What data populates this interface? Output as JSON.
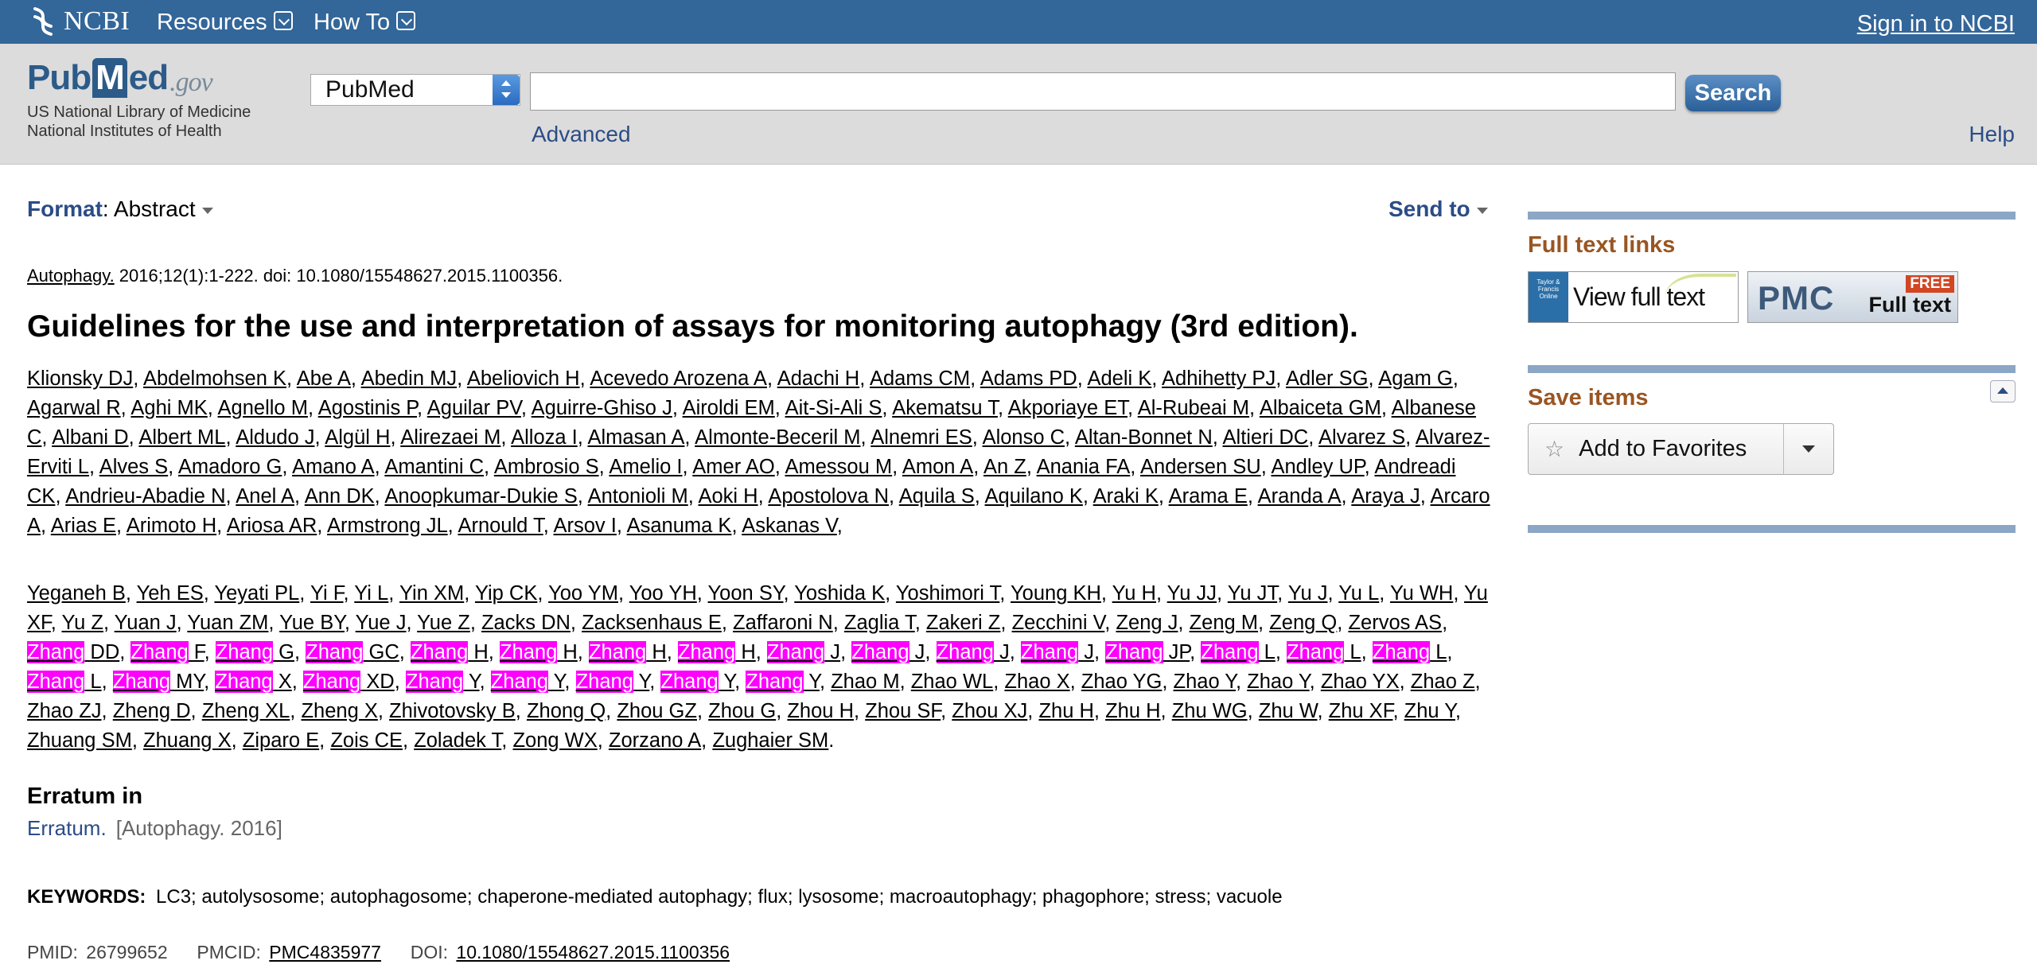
{
  "topbar": {
    "logo": "NCBI",
    "menu": [
      "Resources",
      "How To"
    ],
    "signin": "Sign in to NCBI"
  },
  "header": {
    "logo_pub": "Pub",
    "logo_m": "M",
    "logo_ed": "ed",
    "logo_gov": ".gov",
    "logo_sub1": "US National Library of Medicine",
    "logo_sub2": "National Institutes of Health",
    "db_select": "PubMed",
    "search_value": "",
    "search_button": "Search",
    "advanced": "Advanced",
    "help": "Help"
  },
  "format": {
    "label": "Format",
    "sep": ":",
    "value": "Abstract"
  },
  "send_to": "Send to",
  "citation": {
    "journal": "Autophagy.",
    "details": " 2016;12(1):1-222. doi: 10.1080/15548627.2015.1100356."
  },
  "title": "Guidelines for the use and interpretation of assays for monitoring autophagy (3rd edition).",
  "authors_part1": [
    "Klionsky DJ",
    "Abdelmohsen K",
    "Abe A",
    "Abedin MJ",
    "Abeliovich H",
    "Acevedo Arozena A",
    "Adachi H",
    "Adams CM",
    "Adams PD",
    "Adeli K",
    "Adhihetty PJ",
    "Adler SG",
    "Agam G",
    "Agarwal R",
    "Aghi MK",
    "Agnello M",
    "Agostinis P",
    "Aguilar PV",
    "Aguirre-Ghiso J",
    "Airoldi EM",
    "Ait-Si-Ali S",
    "Akematsu T",
    "Akporiaye ET",
    "Al-Rubeai M",
    "Albaiceta GM",
    "Albanese C",
    "Albani D",
    "Albert ML",
    "Aldudo J",
    "Algül H",
    "Alirezaei M",
    "Alloza I",
    "Almasan A",
    "Almonte-Beceril M",
    "Alnemri ES",
    "Alonso C",
    "Altan-Bonnet N",
    "Altieri DC",
    "Alvarez S",
    "Alvarez-Erviti L",
    "Alves S",
    "Amadoro G",
    "Amano A",
    "Amantini C",
    "Ambrosio S",
    "Amelio I",
    "Amer AO",
    "Amessou M",
    "Amon A",
    "An Z",
    "Anania FA",
    "Andersen SU",
    "Andley UP",
    "Andreadi CK",
    "Andrieu-Abadie N",
    "Anel A",
    "Ann DK",
    "Anoopkumar-Dukie S",
    "Antonioli M",
    "Aoki H",
    "Apostolova N",
    "Aquila S",
    "Aquilano K",
    "Araki K",
    "Arama E",
    "Aranda A",
    "Araya J",
    "Arcaro A",
    "Arias E",
    "Arimoto H",
    "Ariosa AR",
    "Armstrong JL",
    "Arnould T",
    "Arsov I",
    "Asanuma K",
    "Askanas V"
  ],
  "authors_part2": [
    {
      "n": "Yeganeh B"
    },
    {
      "n": "Yeh ES"
    },
    {
      "n": "Yeyati PL"
    },
    {
      "n": "Yi F"
    },
    {
      "n": "Yi L"
    },
    {
      "n": "Yin XM"
    },
    {
      "n": "Yip CK"
    },
    {
      "n": "Yoo YM"
    },
    {
      "n": "Yoo YH"
    },
    {
      "n": "Yoon SY"
    },
    {
      "n": "Yoshida K"
    },
    {
      "n": "Yoshimori T"
    },
    {
      "n": "Young KH"
    },
    {
      "n": "Yu H"
    },
    {
      "n": "Yu JJ"
    },
    {
      "n": "Yu JT"
    },
    {
      "n": "Yu J"
    },
    {
      "n": "Yu L"
    },
    {
      "n": "Yu WH"
    },
    {
      "n": "Yu XF"
    },
    {
      "n": "Yu Z"
    },
    {
      "n": "Yuan J"
    },
    {
      "n": "Yuan ZM"
    },
    {
      "n": "Yue BY"
    },
    {
      "n": "Yue J"
    },
    {
      "n": "Yue Z"
    },
    {
      "n": "Zacks DN"
    },
    {
      "n": "Zacksenhaus E"
    },
    {
      "n": "Zaffaroni N"
    },
    {
      "n": "Zaglia T"
    },
    {
      "n": "Zakeri Z"
    },
    {
      "n": "Zecchini V"
    },
    {
      "n": "Zeng J"
    },
    {
      "n": "Zeng M"
    },
    {
      "n": "Zeng Q"
    },
    {
      "n": "Zervos AS"
    },
    {
      "h": "Zhang",
      "r": "DD"
    },
    {
      "h": "Zhang",
      "r": "F"
    },
    {
      "h": "Zhang",
      "r": "G"
    },
    {
      "h": "Zhang",
      "r": "GC"
    },
    {
      "h": "Zhang",
      "r": "H"
    },
    {
      "h": "Zhang",
      "r": "H"
    },
    {
      "h": "Zhang",
      "r": "H"
    },
    {
      "h": "Zhang",
      "r": "H"
    },
    {
      "h": "Zhang",
      "r": "J"
    },
    {
      "h": "Zhang",
      "r": "J"
    },
    {
      "h": "Zhang",
      "r": "J"
    },
    {
      "h": "Zhang",
      "r": "J"
    },
    {
      "h": "Zhang",
      "r": "JP"
    },
    {
      "h": "Zhang",
      "r": "L"
    },
    {
      "h": "Zhang",
      "r": "L"
    },
    {
      "h": "Zhang",
      "r": "L"
    },
    {
      "h": "Zhang",
      "r": "L"
    },
    {
      "h": "Zhang",
      "r": "MY"
    },
    {
      "h": "Zhang",
      "r": "X"
    },
    {
      "h": "Zhang",
      "r": "XD"
    },
    {
      "h": "Zhang",
      "r": "Y"
    },
    {
      "h": "Zhang",
      "r": "Y"
    },
    {
      "h": "Zhang",
      "r": "Y"
    },
    {
      "h": "Zhang",
      "r": "Y"
    },
    {
      "h": "Zhang",
      "r": "Y"
    },
    {
      "n": "Zhao M"
    },
    {
      "n": "Zhao WL"
    },
    {
      "n": "Zhao X"
    },
    {
      "n": "Zhao YG"
    },
    {
      "n": "Zhao Y"
    },
    {
      "n": "Zhao Y"
    },
    {
      "n": "Zhao YX"
    },
    {
      "n": "Zhao Z"
    },
    {
      "n": "Zhao ZJ"
    },
    {
      "n": "Zheng D"
    },
    {
      "n": "Zheng XL"
    },
    {
      "n": "Zheng X"
    },
    {
      "n": "Zhivotovsky B"
    },
    {
      "n": "Zhong Q"
    },
    {
      "n": "Zhou GZ"
    },
    {
      "n": "Zhou G"
    },
    {
      "n": "Zhou H"
    },
    {
      "n": "Zhou SF"
    },
    {
      "n": "Zhou XJ"
    },
    {
      "n": "Zhu H"
    },
    {
      "n": "Zhu H"
    },
    {
      "n": "Zhu WG"
    },
    {
      "n": "Zhu W"
    },
    {
      "n": "Zhu XF"
    },
    {
      "n": "Zhu Y"
    },
    {
      "n": "Zhuang SM"
    },
    {
      "n": "Zhuang X"
    },
    {
      "n": "Ziparo E"
    },
    {
      "n": "Zois CE"
    },
    {
      "n": "Zoladek T"
    },
    {
      "n": "Zong WX"
    },
    {
      "n": "Zorzano A"
    },
    {
      "n": "Zughaier SM"
    }
  ],
  "erratum": {
    "heading": "Erratum in",
    "link": "Erratum.",
    "source": "[Autophagy. 2016]"
  },
  "keywords": {
    "label": "KEYWORDS:",
    "text": "LC3; autolysosome; autophagosome; chaperone-mediated autophagy; flux; lysosome; macroautophagy; phagophore; stress; vacuole"
  },
  "ids": {
    "pmid_label": "PMID:",
    "pmid": "26799652",
    "pmcid_label": "PMCID:",
    "pmcid": "PMC4835977",
    "doi_label": "DOI:",
    "doi": "10.1080/15548627.2015.1100356"
  },
  "sidebar": {
    "full_text_heading": "Full text links",
    "tf_logo": "Taylor & Francis Online",
    "tf_label": "View full text",
    "pmc_label": "PMC",
    "pmc_free": "FREE",
    "pmc_full": "Full text",
    "save_heading": "Save items",
    "favorites": "Add to Favorites"
  },
  "colors": {
    "ncbi_blue": "#336699",
    "link_blue": "#2b4c86",
    "highlight": "#ff00ff",
    "sidebar_heading": "#995522"
  }
}
